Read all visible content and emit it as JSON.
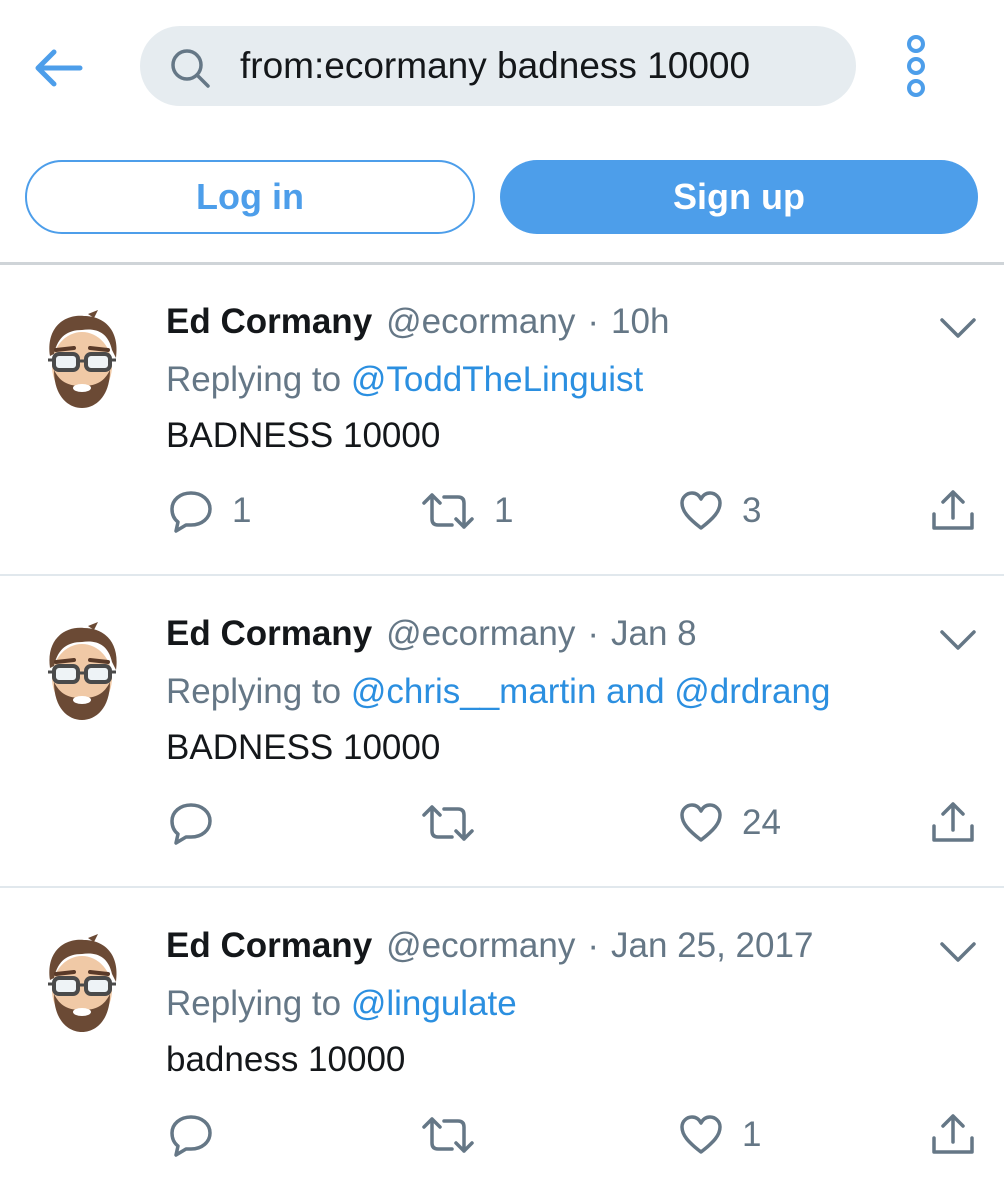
{
  "search": {
    "query": "from:ecormany badness 10000"
  },
  "auth": {
    "login_label": "Log in",
    "signup_label": "Sign up"
  },
  "colors": {
    "accent": "#4d9eea",
    "link": "#2b8fe0",
    "secondary_text": "#657786",
    "search_bg": "#e6ecf0"
  },
  "icons": {
    "back": "arrow-left-icon",
    "search": "search-icon",
    "more": "more-vertical-icon",
    "caret": "chevron-down-icon",
    "reply": "reply-icon",
    "retweet": "retweet-icon",
    "like": "heart-icon",
    "share": "share-icon"
  },
  "tweets": [
    {
      "name": "Ed Cormany",
      "handle": "@ecormany",
      "separator": "·",
      "time": "10h",
      "replying_prefix": "Replying to ",
      "replying_to": "@ToddTheLinguist",
      "text": "BADNESS 10000",
      "replies": "1",
      "retweets": "1",
      "likes": "3"
    },
    {
      "name": "Ed Cormany",
      "handle": "@ecormany",
      "separator": "·",
      "time": "Jan 8",
      "replying_prefix": "Replying to ",
      "replying_to": "@chris__martin and @drdrang",
      "text": "BADNESS 10000",
      "replies": "",
      "retweets": "",
      "likes": "24"
    },
    {
      "name": "Ed Cormany",
      "handle": "@ecormany",
      "separator": "·",
      "time": "Jan 25, 2017",
      "replying_prefix": "Replying to ",
      "replying_to": "@lingulate",
      "text": "badness 10000",
      "replies": "",
      "retweets": "",
      "likes": "1"
    }
  ]
}
